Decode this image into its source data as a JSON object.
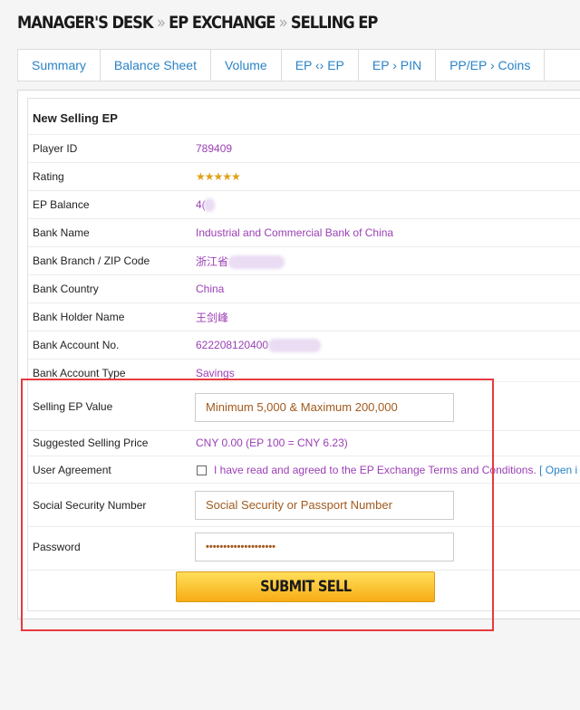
{
  "breadcrumb": {
    "part1": "MANAGER'S DESK",
    "sep": "»",
    "part2": "EP EXCHANGE",
    "part3": "SELLING EP"
  },
  "tabs": [
    "Summary",
    "Balance Sheet",
    "Volume",
    "EP ‹› EP",
    "EP › PIN",
    "PP/EP › Coins"
  ],
  "panel": {
    "title": "New Selling EP"
  },
  "fields": {
    "player_id": {
      "label": "Player ID",
      "value": "789409"
    },
    "rating": {
      "label": "Rating",
      "value": "★★★★★"
    },
    "ep_balance": {
      "label": "EP Balance",
      "value": "4("
    },
    "bank_name": {
      "label": "Bank Name",
      "value": "Industrial and Commercial Bank of China"
    },
    "bank_branch": {
      "label": "Bank Branch / ZIP Code",
      "value": "浙江省"
    },
    "bank_country": {
      "label": "Bank Country",
      "value": "China"
    },
    "bank_holder": {
      "label": "Bank Holder Name",
      "value": "王剑峰"
    },
    "bank_account_no": {
      "label": "Bank Account No.",
      "value": "622208120400"
    },
    "bank_account_type": {
      "label": "Bank Account Type",
      "value": "Savings"
    }
  },
  "form": {
    "selling_ep": {
      "label": "Selling EP Value",
      "placeholder": "Minimum 5,000 & Maximum 200,000"
    },
    "suggested_price": {
      "label": "Suggested Selling Price",
      "value": "CNY 0.00  (EP 100 = CNY 6.23)"
    },
    "agreement": {
      "label": "User Agreement",
      "text": "I have read and agreed to the EP Exchange Terms and Conditions.",
      "link": "[ Open i"
    },
    "ssn": {
      "label": "Social Security Number",
      "placeholder": "Social Security or Passport Number"
    },
    "password": {
      "label": "Password",
      "value": "••••••••••••••••••••"
    },
    "submit_label": "SUBMIT SELL"
  }
}
